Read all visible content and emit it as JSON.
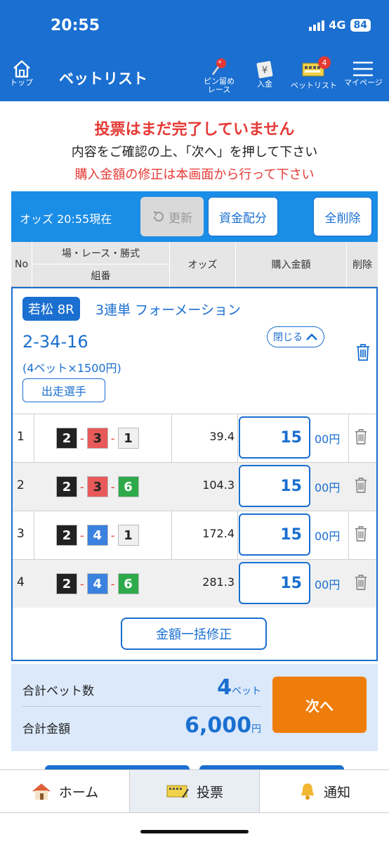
{
  "status": {
    "time": "20:55",
    "network": "4G",
    "battery": "84"
  },
  "header": {
    "title": "ベットリスト",
    "nav": {
      "top": "トップ",
      "pin_line1": "ピン留め",
      "pin_line2": "レース",
      "deposit": "入金",
      "betlist": "ベットリスト",
      "betlist_badge": "4",
      "mypage": "マイページ"
    }
  },
  "messages": {
    "warning": "投票はまだ完了していません",
    "confirm": "内容をご確認の上、「次へ」を押して下さい",
    "note": "購入金額の修正は本画面から行って下さい"
  },
  "odds_bar": {
    "label": "オッズ 20:55現在",
    "refresh": "更新",
    "allocate": "資金配分",
    "delete_all": "全削除"
  },
  "table_header": {
    "no": "No",
    "race": "場・レース・勝式",
    "combo": "組番",
    "odds": "オッズ",
    "amount": "購入金額",
    "delete": "削除"
  },
  "bet": {
    "venue": "若松 8R",
    "type": "3連単 フォーメーション",
    "combination": "2-34-16",
    "detail": "(4ベット×1500円)",
    "close": "閉じる",
    "racers": "出走選手",
    "rows": [
      {
        "no": "1",
        "b1": "2",
        "b2": "3",
        "b3": "1",
        "odds": "39.4",
        "amount": "15",
        "unit": "00円"
      },
      {
        "no": "2",
        "b1": "2",
        "b2": "3",
        "b3": "6",
        "odds": "104.3",
        "amount": "15",
        "unit": "00円"
      },
      {
        "no": "3",
        "b1": "2",
        "b2": "4",
        "b3": "1",
        "odds": "172.4",
        "amount": "15",
        "unit": "00円"
      },
      {
        "no": "4",
        "b1": "2",
        "b2": "4",
        "b3": "6",
        "odds": "281.3",
        "amount": "15",
        "unit": "00円"
      }
    ],
    "bulk_edit": "金額一括修正"
  },
  "summary": {
    "count_label": "合計ベット数",
    "count_value": "4",
    "count_unit": "ベット",
    "total_label": "合計金額",
    "total_value": "6,000",
    "total_unit": "円",
    "next": "次へ"
  },
  "tabbar": {
    "home": "ホーム",
    "vote": "投票",
    "notice": "通知"
  },
  "colors": {
    "primary": "#1a6fd0",
    "accent": "#ef7d0b",
    "warning": "#e53935",
    "boat1": "#f0f0f0",
    "boat2": "#222222",
    "boat3": "#e85a5a",
    "boat4": "#3b82e0",
    "boat6": "#2eaa4a"
  }
}
